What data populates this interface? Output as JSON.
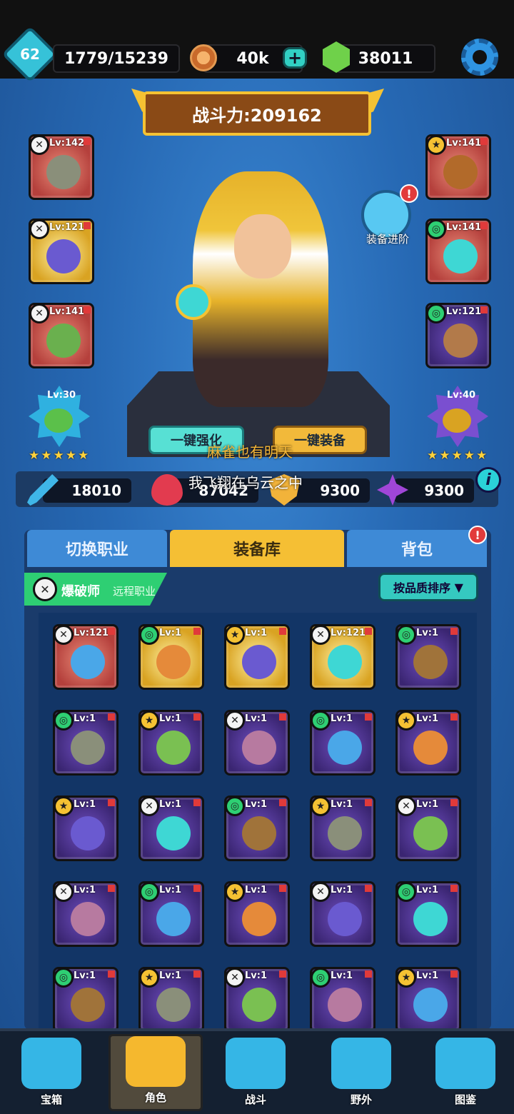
{
  "topbar": {
    "level": "62",
    "exp": "1779/15239",
    "coins": "40k",
    "gems": "38011",
    "icons": [
      "level-badge",
      "coin-icon",
      "plus-icon",
      "gem-icon",
      "gear-icon"
    ]
  },
  "power": {
    "label": "战斗力:209162"
  },
  "equipment_left": [
    {
      "lv": "Lv:142",
      "quality": "red"
    },
    {
      "lv": "Lv:121",
      "quality": "gold"
    },
    {
      "lv": "Lv:141",
      "quality": "red"
    }
  ],
  "equipment_right": [
    {
      "lv": "Lv:141",
      "quality": "red"
    },
    {
      "lv": "Lv:141",
      "quality": "red"
    },
    {
      "lv": "Lv:121",
      "quality": "purple"
    }
  ],
  "pet_left": {
    "lv": "Lv:30",
    "stars": "★★★★★"
  },
  "pet_right": {
    "lv": "Lv:40",
    "stars": "★★★★★"
  },
  "upgrade": {
    "label": "装备进阶",
    "alert": "!"
  },
  "buttons": {
    "auto_enhance": "一键强化",
    "auto_equip": "一键装备"
  },
  "overlay": {
    "line1": "麻雀也有明天",
    "line2": "我飞翔在乌云之中"
  },
  "stats": {
    "attack": "18010",
    "hp": "87042",
    "defense": "9300",
    "crit": "9300",
    "info": "i"
  },
  "tabs": {
    "switch_class": "切换职业",
    "equipment_library": "装备库",
    "backpack": "背包",
    "alert": "!"
  },
  "class": {
    "name": "爆破师",
    "type": "远程职业"
  },
  "sort": {
    "label": "按品质排序"
  },
  "grid": [
    [
      {
        "lv": "Lv:121",
        "q": "red"
      },
      {
        "lv": "Lv:1",
        "q": "gold"
      },
      {
        "lv": "Lv:1",
        "q": "gold"
      },
      {
        "lv": "Lv:121",
        "q": "gold"
      },
      {
        "lv": "Lv:1",
        "q": "purple"
      }
    ],
    [
      {
        "lv": "Lv:1",
        "q": "purple"
      },
      {
        "lv": "Lv:1",
        "q": "purple"
      },
      {
        "lv": "Lv:1",
        "q": "purple"
      },
      {
        "lv": "Lv:1",
        "q": "purple"
      },
      {
        "lv": "Lv:1",
        "q": "purple"
      }
    ],
    [
      {
        "lv": "Lv:1",
        "q": "purple"
      },
      {
        "lv": "Lv:1",
        "q": "purple"
      },
      {
        "lv": "Lv:1",
        "q": "purple"
      },
      {
        "lv": "Lv:1",
        "q": "purple"
      },
      {
        "lv": "Lv:1",
        "q": "purple"
      }
    ],
    [
      {
        "lv": "Lv:1",
        "q": "purple"
      },
      {
        "lv": "Lv:1",
        "q": "purple"
      },
      {
        "lv": "Lv:1",
        "q": "purple"
      },
      {
        "lv": "Lv:1",
        "q": "purple"
      },
      {
        "lv": "Lv:1",
        "q": "purple"
      }
    ],
    [
      {
        "lv": "Lv:1",
        "q": "purple"
      },
      {
        "lv": "Lv:1",
        "q": "purple"
      },
      {
        "lv": "Lv:1",
        "q": "purple"
      },
      {
        "lv": "Lv:1",
        "q": "purple"
      },
      {
        "lv": "Lv:1",
        "q": "purple"
      }
    ]
  ],
  "nav": [
    {
      "label": "宝箱",
      "color": "#35b6e6"
    },
    {
      "label": "角色",
      "color": "#f5b82e"
    },
    {
      "label": "战斗",
      "color": "#35b6e6"
    },
    {
      "label": "野外",
      "color": "#35b6e6"
    },
    {
      "label": "图鉴",
      "color": "#35b6e6"
    }
  ]
}
